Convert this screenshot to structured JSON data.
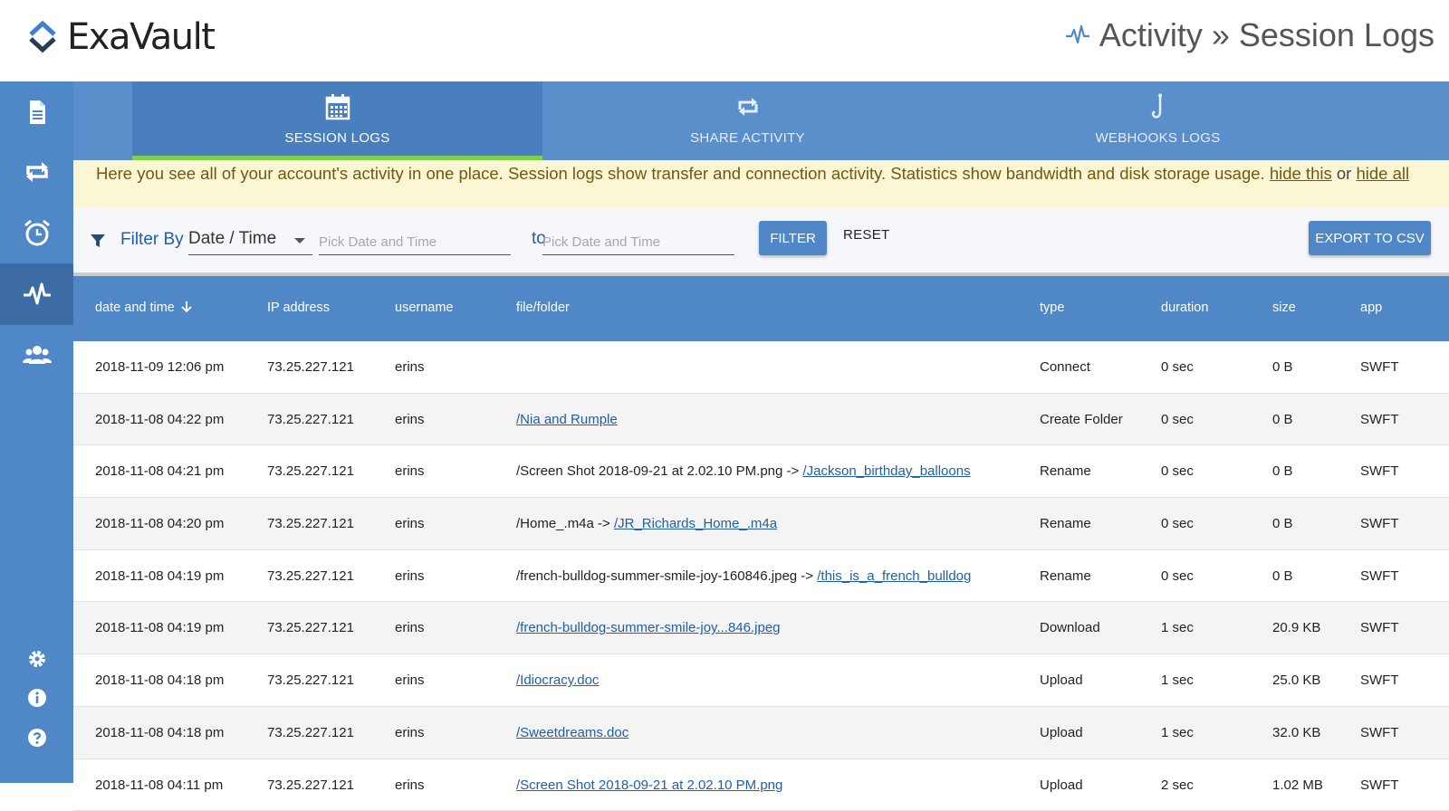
{
  "brand": {
    "name": "ExaVault"
  },
  "header": {
    "title": "Activity » Session Logs",
    "icon": "pulse-icon"
  },
  "sidebar": {
    "items": [
      {
        "name": "files",
        "icon": "document-icon"
      },
      {
        "name": "shares",
        "icon": "share-arrows-icon"
      },
      {
        "name": "notifications",
        "icon": "alarm-clock-icon"
      },
      {
        "name": "activity",
        "icon": "pulse-icon",
        "active": true
      },
      {
        "name": "users",
        "icon": "users-icon"
      }
    ],
    "bottom": [
      {
        "name": "settings",
        "icon": "gear-icon"
      },
      {
        "name": "info",
        "icon": "info-icon"
      },
      {
        "name": "help",
        "icon": "help-icon"
      }
    ]
  },
  "tabs": [
    {
      "label": "SESSION LOGS",
      "icon": "calendar-icon",
      "active": true
    },
    {
      "label": "SHARE ACTIVITY",
      "icon": "share-arrows-icon"
    },
    {
      "label": "WEBHOOKS LOGS",
      "icon": "hook-icon"
    }
  ],
  "notice": {
    "text": "Here you see all of your account's activity in one place. Session logs show transfer and connection activity. Statistics show bandwidth and disk storage usage. ",
    "hide_this": "hide this",
    "or": "or",
    "hide_all": "hide all"
  },
  "filter": {
    "label": "Filter By",
    "selected": "Date / Time",
    "from_placeholder": "Pick Date and Time",
    "to_label": "to",
    "to_placeholder": "Pick Date and Time",
    "filter_button": "FILTER",
    "reset_button": "RESET",
    "export_button": "EXPORT TO CSV"
  },
  "table": {
    "columns": [
      "date and time",
      "IP address",
      "username",
      "file/folder",
      "type",
      "duration",
      "size",
      "app"
    ],
    "rows": [
      {
        "date": "2018-11-09 12:06 pm",
        "ip": "73.25.227.121",
        "user": "erins",
        "file_prefix": "",
        "file_link": "",
        "type": "Connect",
        "duration": "0 sec",
        "size": "0 B",
        "app": "SWFT"
      },
      {
        "date": "2018-11-08 04:22 pm",
        "ip": "73.25.227.121",
        "user": "erins",
        "file_prefix": "",
        "file_link": "/Nia and Rumple",
        "type": "Create Folder",
        "duration": "0 sec",
        "size": "0 B",
        "app": "SWFT"
      },
      {
        "date": "2018-11-08 04:21 pm",
        "ip": "73.25.227.121",
        "user": "erins",
        "file_prefix": "/Screen Shot 2018-09-21 at 2.02.10 PM.png -> ",
        "file_link": "/Jackson_birthday_balloons",
        "type": "Rename",
        "duration": "0 sec",
        "size": "0 B",
        "app": "SWFT"
      },
      {
        "date": "2018-11-08 04:20 pm",
        "ip": "73.25.227.121",
        "user": "erins",
        "file_prefix": "/Home_.m4a -> ",
        "file_link": "/JR_Richards_Home_.m4a",
        "type": "Rename",
        "duration": "0 sec",
        "size": "0 B",
        "app": "SWFT"
      },
      {
        "date": "2018-11-08 04:19 pm",
        "ip": "73.25.227.121",
        "user": "erins",
        "file_prefix": "/french-bulldog-summer-smile-joy-160846.jpeg -> ",
        "file_link": "/this_is_a_french_bulldog",
        "type": "Rename",
        "duration": "0 sec",
        "size": "0 B",
        "app": "SWFT"
      },
      {
        "date": "2018-11-08 04:19 pm",
        "ip": "73.25.227.121",
        "user": "erins",
        "file_prefix": "",
        "file_link": "/french-bulldog-summer-smile-joy...846.jpeg",
        "type": "Download",
        "duration": "1 sec",
        "size": "20.9 KB",
        "app": "SWFT"
      },
      {
        "date": "2018-11-08 04:18 pm",
        "ip": "73.25.227.121",
        "user": "erins",
        "file_prefix": "",
        "file_link": "/Idiocracy.doc",
        "type": "Upload",
        "duration": "1 sec",
        "size": "25.0 KB",
        "app": "SWFT"
      },
      {
        "date": "2018-11-08 04:18 pm",
        "ip": "73.25.227.121",
        "user": "erins",
        "file_prefix": "",
        "file_link": "/Sweetdreams.doc",
        "type": "Upload",
        "duration": "1 sec",
        "size": "32.0 KB",
        "app": "SWFT"
      },
      {
        "date": "2018-11-08 04:11 pm",
        "ip": "73.25.227.121",
        "user": "erins",
        "file_prefix": "",
        "file_link": "/Screen Shot 2018-09-21 at 2.02.10 PM.png",
        "type": "Upload",
        "duration": "2 sec",
        "size": "1.02 MB",
        "app": "SWFT"
      }
    ]
  },
  "colors": {
    "sidebar": "#4f87c7",
    "sidebar_active": "#3d6ca5",
    "tab_bar": "#5a8fcb",
    "tab_active_indicator": "#7fd14c",
    "notice_bg": "#fbf6d3",
    "link": "#1f5fa8"
  }
}
